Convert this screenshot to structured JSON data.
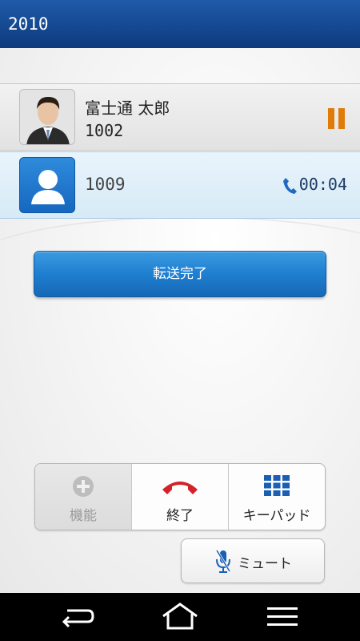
{
  "status_bar": {
    "title": "2010"
  },
  "calls": {
    "held": {
      "name": "富士通 太郎",
      "number": "1002",
      "state_icon": "pause-icon"
    },
    "active": {
      "number": "1009",
      "duration": "00:04",
      "state_icon": "phone-icon"
    }
  },
  "transfer_button": {
    "label": "転送完了"
  },
  "actions": {
    "function": {
      "label": "機能",
      "icon": "plus-circle-icon",
      "enabled": false
    },
    "end": {
      "label": "終了",
      "icon": "hang-up-icon"
    },
    "keypad": {
      "label": "キーパッド",
      "icon": "keypad-grid-icon"
    }
  },
  "mute_button": {
    "label": "ミュート",
    "icon": "mic-muted-icon"
  },
  "navigation": [
    "back-icon",
    "home-icon",
    "menu-icon"
  ],
  "colors": {
    "header": "#174c96",
    "accent_blue": "#1f7fd0",
    "hold_orange": "#e07b0a",
    "end_red": "#d4222a",
    "keypad_blue": "#1a5fb4"
  }
}
